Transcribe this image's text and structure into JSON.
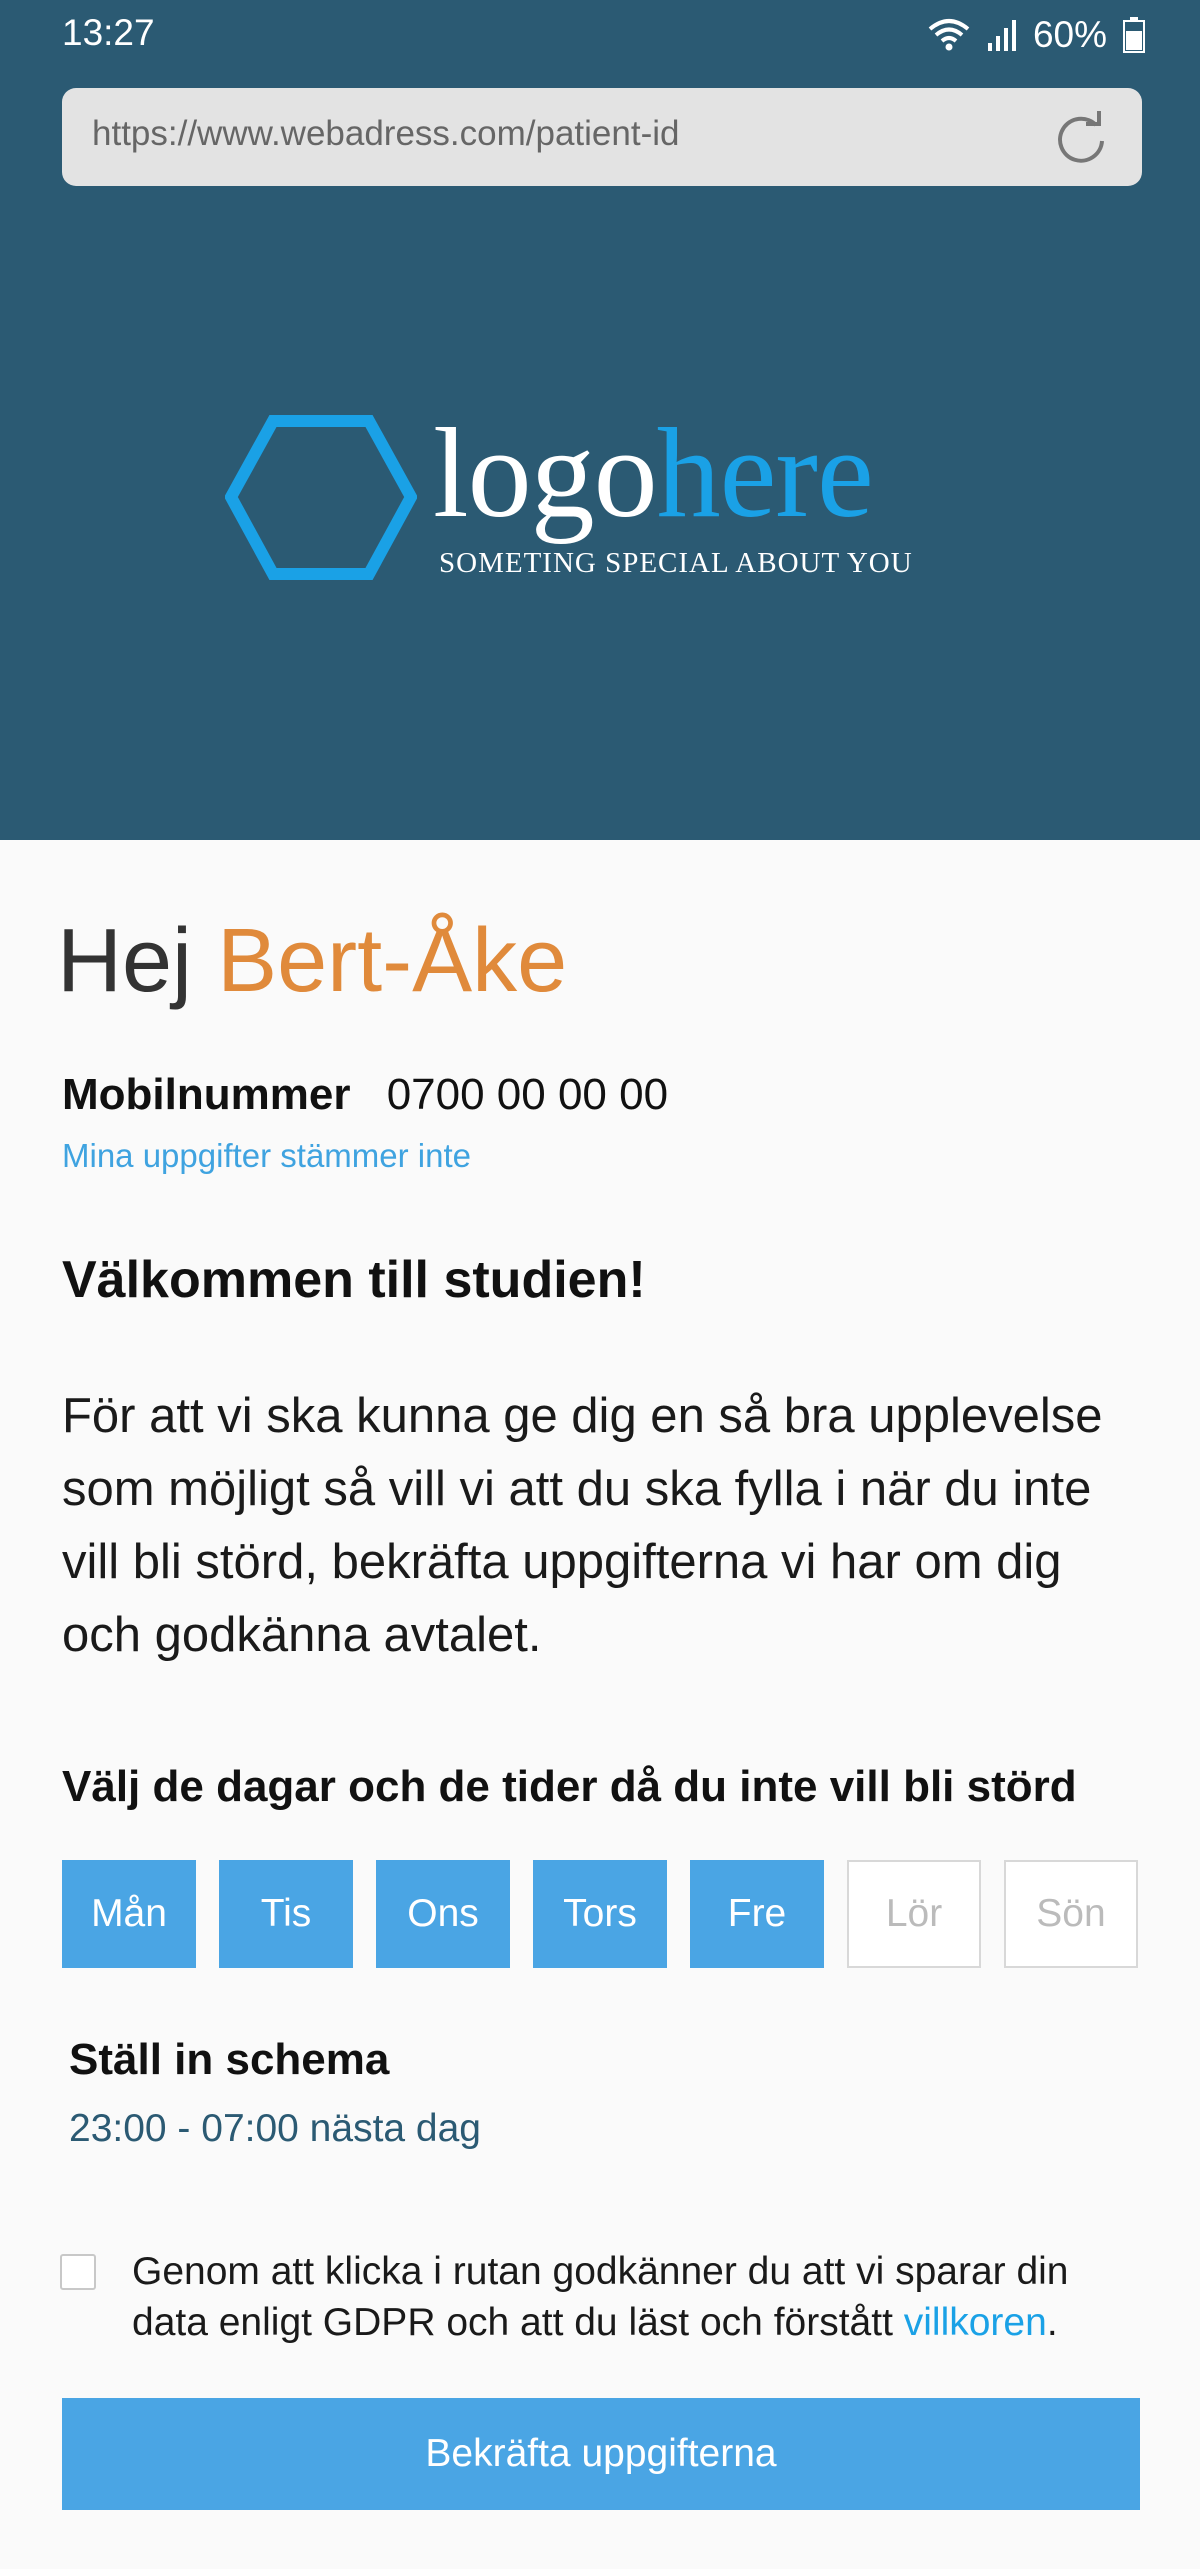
{
  "status_bar": {
    "time": "13:27",
    "battery": "60%"
  },
  "browser": {
    "url": "https://www.webadress.com/patient-id"
  },
  "logo": {
    "word_part1": "logo",
    "word_part2": "here",
    "tagline": "SOMETING SPECIAL ABOUT YOU",
    "accent_color": "#1aa1e6"
  },
  "greeting": {
    "hello": "Hej",
    "name": "Bert-Åke"
  },
  "contact": {
    "mobile_label": "Mobilnummer",
    "mobile_value": "0700 00 00 00",
    "wrong_info_link": "Mina uppgifter stämmer inte"
  },
  "welcome": {
    "title": "Välkommen till studien!",
    "intro": "För att vi ska kunna ge dig en så bra upplevelse som möjligt så vill vi att du ska fylla i när du inte vill bli störd, bekräfta uppgifterna vi har om dig och godkänna avtalet."
  },
  "days": {
    "title": "Välj de dagar och de tider då du inte vill bli störd",
    "items": [
      {
        "label": "Mån",
        "selected": true
      },
      {
        "label": "Tis",
        "selected": true
      },
      {
        "label": "Ons",
        "selected": true
      },
      {
        "label": "Tors",
        "selected": true
      },
      {
        "label": "Fre",
        "selected": true
      },
      {
        "label": "Lör",
        "selected": false
      },
      {
        "label": "Sön",
        "selected": false
      }
    ]
  },
  "schedule": {
    "title": "Ställ in schema",
    "time": "23:00 - 07:00 nästa dag"
  },
  "gdpr": {
    "checked": false,
    "text": "Genom att klicka i rutan godkänner du att vi sparar din data enligt GDPR och att du läst och förstått ",
    "link": "villkoren",
    "end": "."
  },
  "confirm_button": "Bekräfta uppgifterna",
  "colors": {
    "header_bg": "#2b5a73",
    "primary": "#4aa5e4",
    "name_orange": "#e08a3b"
  }
}
